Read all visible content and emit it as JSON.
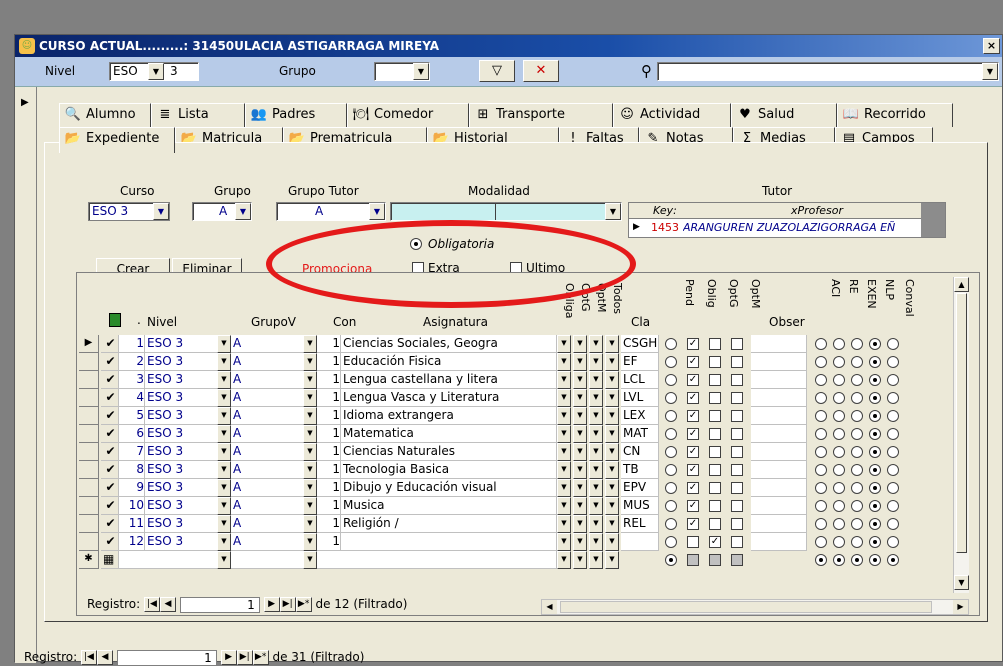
{
  "window": {
    "title": "CURSO ACTUAL.........: 31450ULACIA ASTIGARRAGA MIREYA",
    "close": "×"
  },
  "filter": {
    "nivel_label": "Nivel",
    "nivel_value": "ESO",
    "num_value": "3",
    "grupo_label": "Grupo",
    "grupo_value": "",
    "search_value": ""
  },
  "tabs_row1": [
    {
      "label": "Alumno",
      "icon": "search-icon",
      "glyph": "🔍"
    },
    {
      "label": "Lista",
      "icon": "list-icon",
      "glyph": "≣"
    },
    {
      "label": "Padres",
      "icon": "parents-icon",
      "glyph": "👥"
    },
    {
      "label": "Comedor",
      "icon": "cafeteria-icon",
      "glyph": "🍽"
    },
    {
      "label": "Transporte",
      "icon": "transport-icon",
      "glyph": "⊞"
    },
    {
      "label": "Actividad",
      "icon": "activity-icon",
      "glyph": "☺"
    },
    {
      "label": "Salud",
      "icon": "heart-icon",
      "glyph": "♥"
    },
    {
      "label": "Recorrido",
      "icon": "book-icon",
      "glyph": "📖"
    }
  ],
  "tabs_row2": [
    {
      "label": "Expediente",
      "icon": "folder-icon",
      "glyph": "📂"
    },
    {
      "label": "Matricula",
      "icon": "folder-icon",
      "glyph": "📂"
    },
    {
      "label": "Prematricula",
      "icon": "folder-icon",
      "glyph": "📂"
    },
    {
      "label": "Historial",
      "icon": "folder-icon",
      "glyph": "📂"
    },
    {
      "label": "Faltas",
      "icon": "exclamation-icon",
      "glyph": "!"
    },
    {
      "label": "Notas",
      "icon": "notes-icon",
      "glyph": "✎"
    },
    {
      "label": "Medias",
      "icon": "sigma-icon",
      "glyph": "Σ"
    },
    {
      "label": "Campos",
      "icon": "fields-icon",
      "glyph": "▤"
    }
  ],
  "header": {
    "curso_label": "Curso",
    "grupo_label": "Grupo",
    "grupo_tutor_label": "Grupo Tutor",
    "modalidad_label": "Modalidad",
    "tutor_label": "Tutor",
    "curso_value": "ESO 3",
    "grupo_value": "A",
    "grupo_tutor_value": "A",
    "key_label": "Key:",
    "xprofesor_label": "xProfesor",
    "tutor_key": "1453",
    "tutor_name": "ARANGUREN ZUAZOLAZIGORRAGA EÑ"
  },
  "actions": {
    "crear": "Crear",
    "eliminar": "Eliminar"
  },
  "promo": {
    "label": "Promociona",
    "obligatoria": "Obligatoria",
    "extra": "Extra",
    "ultimo": "Ultimo"
  },
  "columns": {
    "dot": ".",
    "nivel": "Nivel",
    "grupov": "GrupoV",
    "con": "Con",
    "asignatura": "Asignatura",
    "obliga": "Obliga",
    "optg": "OptG",
    "optm": "OptM",
    "todos": "Todos",
    "cla": "Cla",
    "pend": "Pend",
    "oblig": "Oblig",
    "optg2": "OptG",
    "optm2": "OptM",
    "obser": "Obser",
    "aci": "ACI",
    "re": "RE",
    "exen": "EXEN",
    "nlp": "NLP",
    "conval": "Conval"
  },
  "rows": [
    {
      "n": "1",
      "nivel": "ESO 3",
      "g": "A",
      "c": "1",
      "asig": "Ciencias Sociales, Geogra",
      "cla": "CSGH",
      "pend": false,
      "oblig": true,
      "optg": false,
      "optm": false,
      "nlp": true
    },
    {
      "n": "2",
      "nivel": "ESO 3",
      "g": "A",
      "c": "1",
      "asig": "Educación Fisica",
      "cla": "EF",
      "pend": false,
      "oblig": true,
      "optg": false,
      "optm": false,
      "nlp": true
    },
    {
      "n": "3",
      "nivel": "ESO 3",
      "g": "A",
      "c": "1",
      "asig": "Lengua castellana y litera",
      "cla": "LCL",
      "pend": false,
      "oblig": true,
      "optg": false,
      "optm": false,
      "nlp": true
    },
    {
      "n": "4",
      "nivel": "ESO 3",
      "g": "A",
      "c": "1",
      "asig": "Lengua Vasca y Literatura",
      "cla": "LVL",
      "pend": false,
      "oblig": true,
      "optg": false,
      "optm": false,
      "nlp": true
    },
    {
      "n": "5",
      "nivel": "ESO 3",
      "g": "A",
      "c": "1",
      "asig": "Idioma extrangera",
      "cla": "LEX",
      "pend": false,
      "oblig": true,
      "optg": false,
      "optm": false,
      "nlp": true
    },
    {
      "n": "6",
      "nivel": "ESO 3",
      "g": "A",
      "c": "1",
      "asig": "Matematica",
      "cla": "MAT",
      "pend": false,
      "oblig": true,
      "optg": false,
      "optm": false,
      "nlp": true
    },
    {
      "n": "7",
      "nivel": "ESO 3",
      "g": "A",
      "c": "1",
      "asig": "Ciencias Naturales",
      "cla": "CN",
      "pend": false,
      "oblig": true,
      "optg": false,
      "optm": false,
      "nlp": true
    },
    {
      "n": "8",
      "nivel": "ESO 3",
      "g": "A",
      "c": "1",
      "asig": "Tecnologia Basica",
      "cla": "TB",
      "pend": false,
      "oblig": true,
      "optg": false,
      "optm": false,
      "nlp": true
    },
    {
      "n": "9",
      "nivel": "ESO 3",
      "g": "A",
      "c": "1",
      "asig": "Dibujo y Educación visual",
      "cla": "EPV",
      "pend": false,
      "oblig": true,
      "optg": false,
      "optm": false,
      "nlp": true
    },
    {
      "n": "10",
      "nivel": "ESO 3",
      "g": "A",
      "c": "1",
      "asig": "Musica",
      "cla": "MUS",
      "pend": false,
      "oblig": true,
      "optg": false,
      "optm": false,
      "nlp": true
    },
    {
      "n": "11",
      "nivel": "ESO 3",
      "g": "A",
      "c": "1",
      "asig": "Religión /",
      "cla": "REL",
      "pend": false,
      "oblig": true,
      "optg": false,
      "optm": false,
      "nlp": true
    },
    {
      "n": "12",
      "nivel": "ESO 3",
      "g": "A",
      "c": "1",
      "asig": "",
      "cla": "",
      "pend": false,
      "oblig": false,
      "optg": true,
      "optm": false,
      "nlp": true
    }
  ],
  "subnav": {
    "label": "Registro:",
    "current": "1",
    "total": "de 12 (Filtrado)"
  },
  "mainnav": {
    "label": "Registro:",
    "current": "1",
    "total": "de 31 (Filtrado)"
  },
  "colors": {
    "accent": "#e41a1a",
    "title": "#0a246a",
    "filterbar": "#b7cbe8",
    "modalidad_fill": "#c8f0f0"
  }
}
